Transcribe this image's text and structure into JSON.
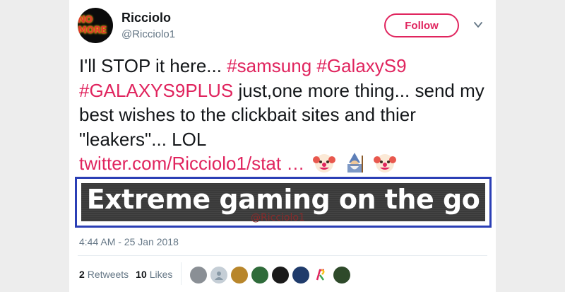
{
  "user": {
    "name": "Ricciolo",
    "handle": "@Ricciolo1",
    "avatar_text": "NO MORE"
  },
  "follow_label": "Follow",
  "tweet": {
    "part1": "I'll STOP it here... ",
    "tag_samsung": "#samsung",
    "space1": " ",
    "tag_galaxys9": "#GalaxyS9",
    "tag_galaxys9plus": "#GALAXYS9PLUS",
    "part2": " just,one more thing... send my best wishes to the clickbait sites and thier \"leakers\"... LOL",
    "link": "twitter.com/Ricciolo1/stat …"
  },
  "media": {
    "title": "Extreme gaming on the go",
    "watermark": "@Ricciolo1"
  },
  "timestamp": "4:44 AM - 25 Jan 2018",
  "stats": {
    "retweets_count": "2",
    "retweets_label": "Retweets",
    "likes_count": "10",
    "likes_label": "Likes"
  },
  "colors": {
    "accent": "#e0245e",
    "highlight_border": "#2b3fb5",
    "muted": "#657786"
  },
  "likers": [
    "liker-avatar-1",
    "liker-avatar-2",
    "liker-avatar-3",
    "liker-avatar-4",
    "liker-avatar-5",
    "liker-avatar-6",
    "liker-avatar-7",
    "liker-avatar-8"
  ]
}
